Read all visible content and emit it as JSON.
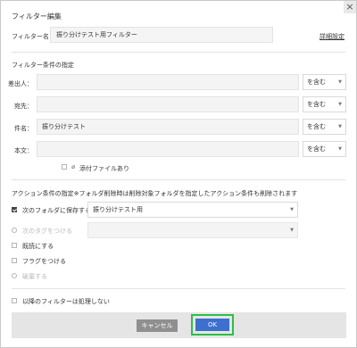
{
  "dialog": {
    "title": "フィルター編集",
    "close_glyph": "×"
  },
  "filter_name": {
    "label": "フィルター名",
    "value": "振り分けテスト用フィルター"
  },
  "detail_link": "詳細設定",
  "conditions": {
    "section_title": "フィルター条件の指定",
    "rows": [
      {
        "label": "差出人：",
        "value": "",
        "operator": "を含む"
      },
      {
        "label": "宛先：",
        "value": "",
        "operator": "を含む"
      },
      {
        "label": "件名：",
        "value": "振り分けテスト",
        "operator": "を含む"
      },
      {
        "label": "本文：",
        "value": "",
        "operator": "を含む"
      }
    ],
    "attachment_label": "添付ファイルあり"
  },
  "actions": {
    "section_title": "アクション条件の指定※フォルダ削除時は削除対象フォルダを指定したアクション条件も削除されます",
    "save_to_folder": {
      "label": "次のフォルダに保存する",
      "checked": true,
      "value": "振り分けテスト用"
    },
    "add_tag": {
      "label": "次のタグをつける",
      "enabled": false,
      "value": ""
    },
    "mark_read": {
      "label": "既読にする"
    },
    "add_flag": {
      "label": "フラグをつける"
    },
    "discard": {
      "label": "破棄する",
      "enabled": false
    }
  },
  "stop_processing": {
    "label": "以降のフィルターは処理しない"
  },
  "buttons": {
    "cancel": "キャンセル",
    "ok": "OK"
  },
  "colors": {
    "ok_button": "#3d6fcf",
    "ok_highlight": "#2dbf4a",
    "cancel_button": "#8f8f8f"
  }
}
